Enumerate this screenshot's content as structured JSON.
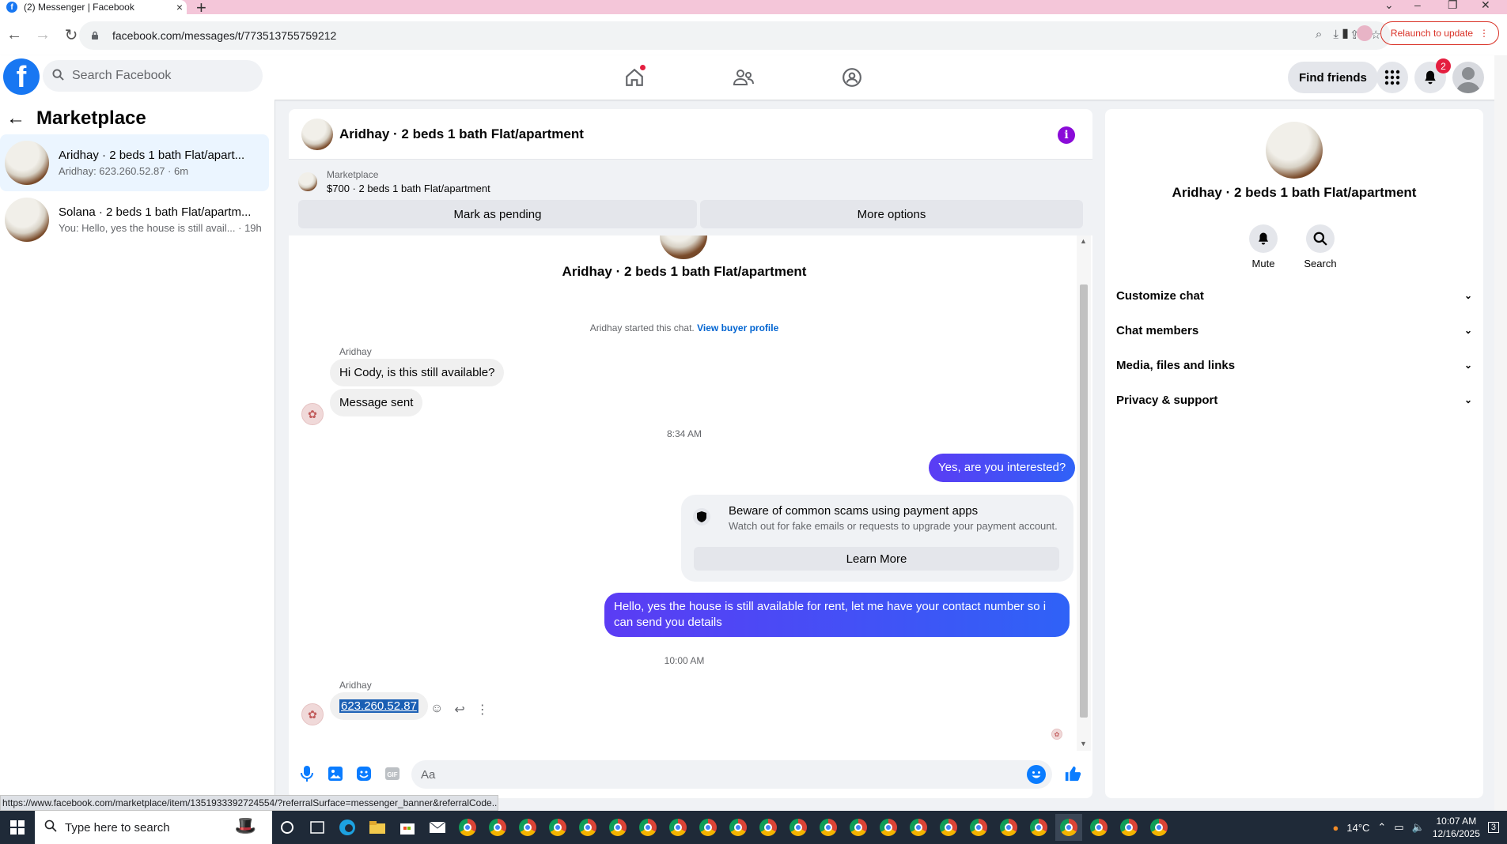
{
  "browser": {
    "tab_title": "(2) Messenger | Facebook",
    "url": "facebook.com/messages/t/7735137557592​12",
    "relaunch_label": "Relaunch to update"
  },
  "facebook": {
    "search_placeholder": "Search Facebook",
    "find_friends_label": "Find friends",
    "notification_count": "2"
  },
  "left_panel": {
    "title": "Marketplace",
    "conversations": [
      {
        "name": "Aridhay · 2 beds 1 bath Flat/apart...",
        "preview": "Aridhay: 623.260.52.87 · 6m"
      },
      {
        "name": "Solana · 2 beds 1 bath Flat/apartm...",
        "preview": "You: Hello, yes the house is still avail... · 19h"
      }
    ]
  },
  "chat": {
    "header_title": "Aridhay · 2 beds 1 bath Flat/apartment",
    "banner": {
      "label": "Marketplace",
      "listing": "$700 · 2 beds 1 bath Flat/apartment",
      "mark_pending_label": "Mark as pending",
      "more_options_label": "More options"
    },
    "intro_name": "Aridhay · 2 beds 1 bath Flat/apartment",
    "started_text": "Aridhay started this chat.",
    "view_buyer_profile": "View buyer profile",
    "messages": {
      "sender1": "Aridhay",
      "in1": "Hi Cody, is this still available?",
      "in2": "Message sent",
      "time1": "8:34 AM",
      "out1": "Yes, are you interested?",
      "scam_title": "Beware of common scams using payment apps",
      "scam_sub": "Watch out for fake emails or requests to upgrade your payment account.",
      "learn_more": "Learn More",
      "out2": "Hello, yes the house is still available for rent, let me have your contact number so i can send you details",
      "time2": "10:00 AM",
      "sender2": "Aridhay",
      "in3": "623.260.52.87"
    },
    "composer_placeholder": "Aa"
  },
  "right_panel": {
    "name": "Aridhay · 2 beds 1 bath Flat/apartment",
    "mute_label": "Mute",
    "search_label": "Search",
    "rows": [
      "Customize chat",
      "Chat members",
      "Media, files and links",
      "Privacy & support"
    ]
  },
  "status_url": "https://www.facebook.com/marketplace/item/1351933392724554/?referralSurface=messenger_banner&referralCode...",
  "taskbar": {
    "search_placeholder": "Type here to search",
    "weather": "14°C",
    "time": "10:07 AM",
    "date": "12/16/2025",
    "notif_count": "3"
  }
}
